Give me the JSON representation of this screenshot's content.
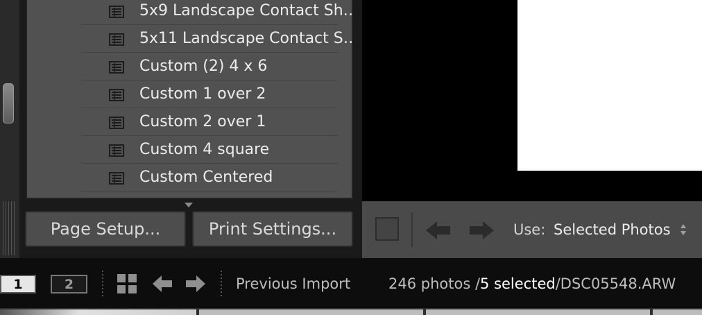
{
  "templates": [
    {
      "label": "5x9 Landscape Contact Sh…",
      "icon": "template-icon"
    },
    {
      "label": "5x11 Landscape Contact S…",
      "icon": "template-icon"
    },
    {
      "label": "Custom (2) 4 x 6",
      "icon": "template-icon"
    },
    {
      "label": "Custom 1 over 2",
      "icon": "template-icon"
    },
    {
      "label": "Custom 2 over 1",
      "icon": "template-icon"
    },
    {
      "label": "Custom 4 square",
      "icon": "template-icon"
    },
    {
      "label": "Custom Centered",
      "icon": "template-icon"
    },
    {
      "label": "",
      "icon": "template-icon"
    }
  ],
  "buttons": {
    "page_setup": "Page Setup...",
    "print_settings": "Print Settings..."
  },
  "toolbar": {
    "use_label": "Use:",
    "use_value": "Selected Photos"
  },
  "filmstrip": {
    "monitor_1": "1",
    "monitor_2": "2",
    "source": "Previous Import",
    "count_prefix": "246 photos /",
    "count_selected": "5 selected",
    "count_file": "/DSC05548.ARW"
  },
  "colors": {
    "panel_bg": "#515151",
    "toolbar_bg": "#4a4a4a",
    "preview_paper": "#ffffff"
  }
}
